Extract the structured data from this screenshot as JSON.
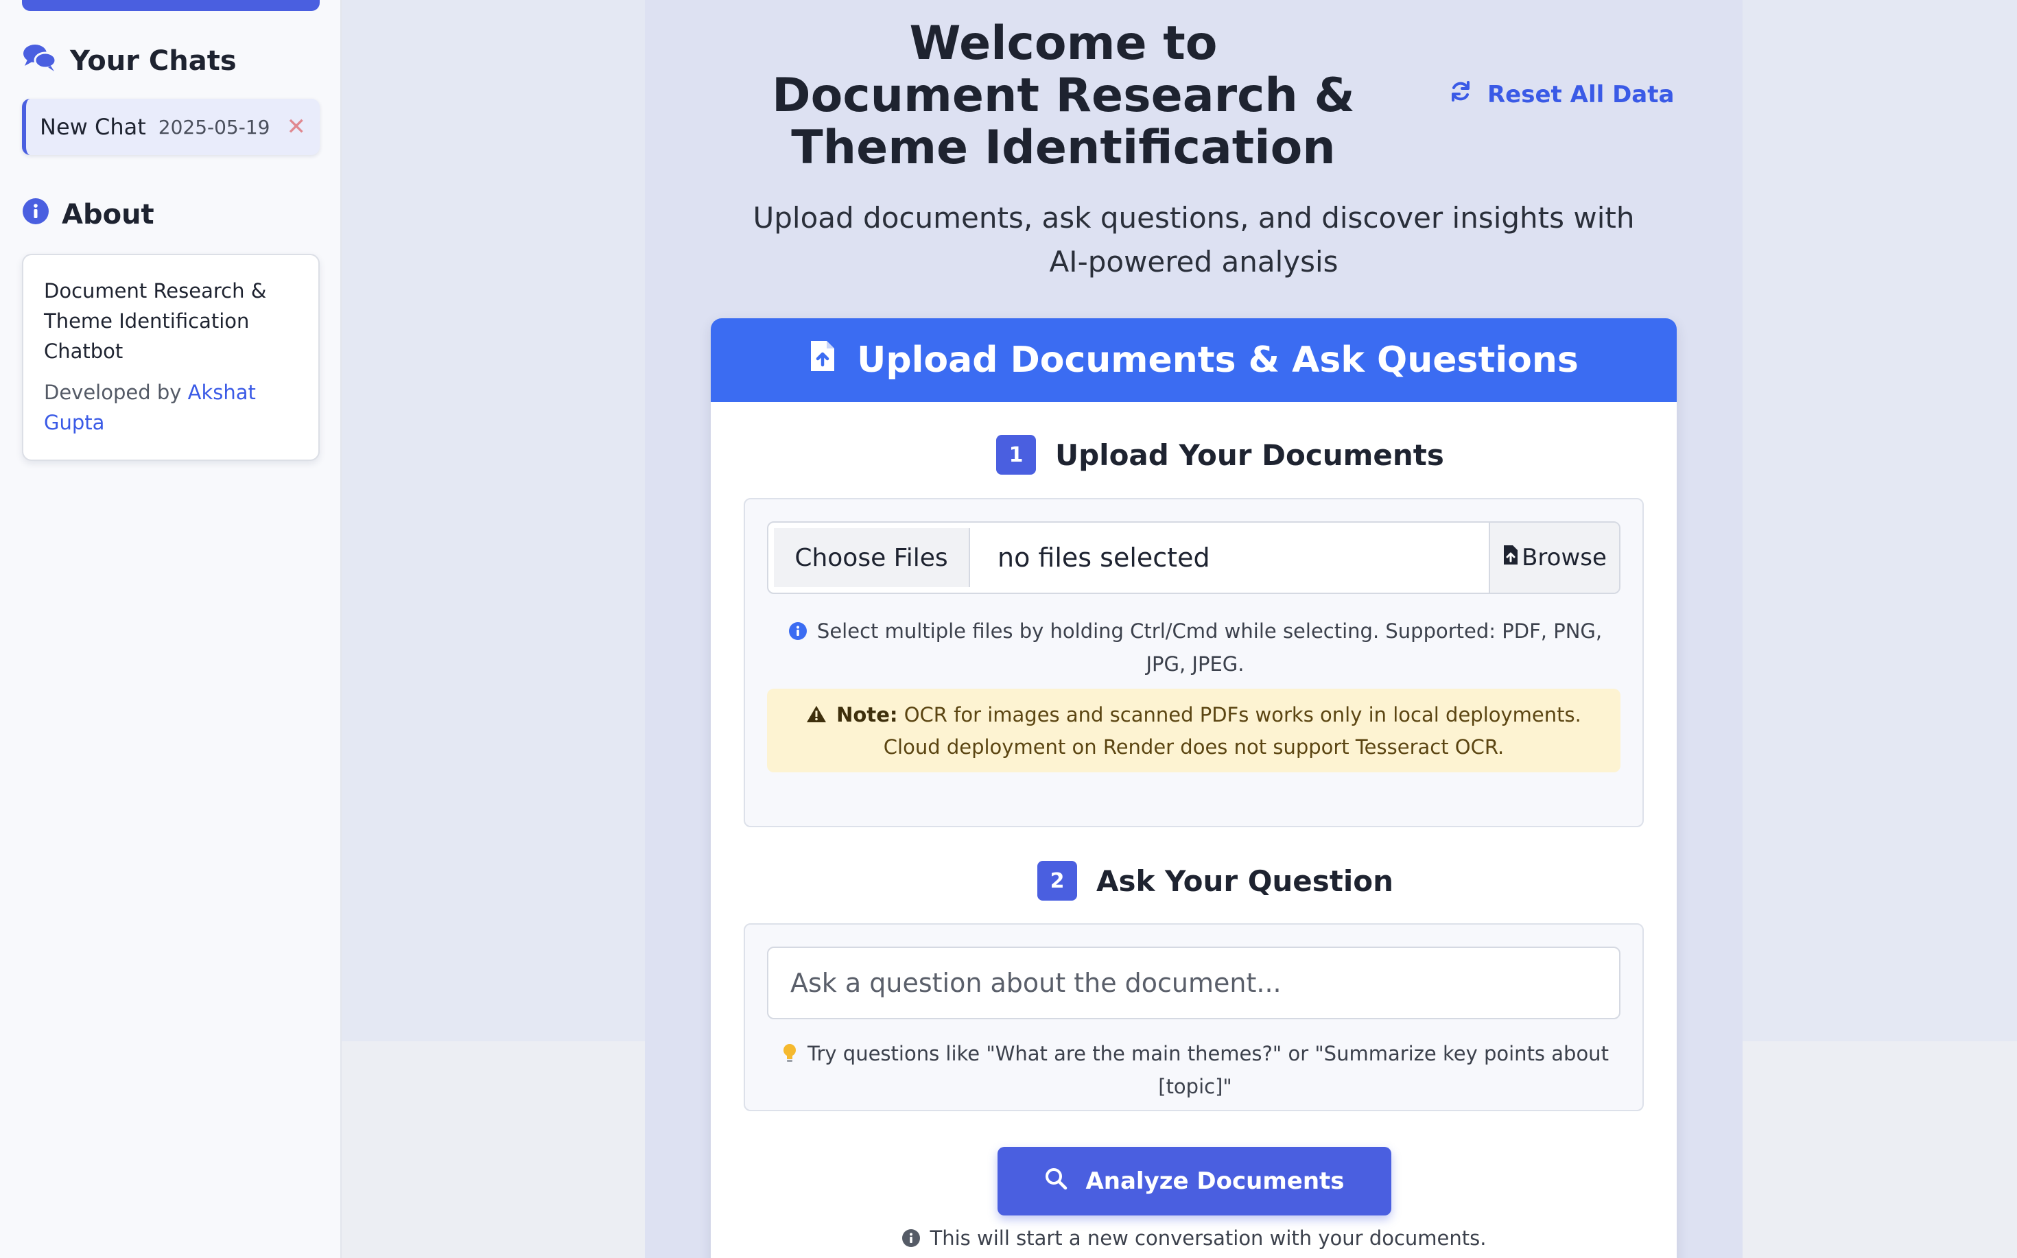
{
  "sidebar": {
    "chats_heading": "Your Chats",
    "chats": [
      {
        "name": "New Chat",
        "date": "2025-05-19"
      }
    ],
    "about_heading": "About",
    "about_description": "Document Research & Theme Identification Chatbot",
    "developed_by_prefix": "Developed by",
    "developer_name": "Akshat Gupta"
  },
  "header": {
    "title": "Welcome to Document Research & Theme Identification",
    "reset_label": "Reset All Data",
    "subtitle": "Upload documents, ask questions, and discover insights with AI-powered analysis"
  },
  "card": {
    "header_title": "Upload Documents & Ask Questions",
    "step1": {
      "number": "1",
      "title": "Upload Your Documents",
      "choose_label": "Choose Files",
      "file_status": "no files selected",
      "browse_label": "Browse",
      "hint": "Select multiple files by holding Ctrl/Cmd while selecting. Supported: PDF, PNG, JPG, JPEG.",
      "note_label": "Note:",
      "note_text": "OCR for images and scanned PDFs works only in local deployments. Cloud deployment on Render does not support Tesseract OCR."
    },
    "step2": {
      "number": "2",
      "title": "Ask Your Question",
      "placeholder": "Ask a question about the document...",
      "hint": "Try questions like \"What are the main themes?\" or \"Summarize key points about [topic]\""
    },
    "analyze_label": "Analyze Documents",
    "footer_note": "This will start a new conversation with your documents."
  },
  "icons": {
    "chats": "comments-icon",
    "about": "info-circle-icon",
    "reset": "refresh-icon",
    "upload": "file-upload-icon",
    "browse": "file-upload-icon",
    "hint": "info-circle-icon",
    "note": "warning-icon",
    "idea": "lightbulb-icon",
    "search": "search-icon"
  },
  "colors": {
    "accent": "#4a5fe0",
    "header_blue": "#3b6cf2",
    "link": "#3a5ae6",
    "note_bg": "#fdf3d2",
    "close_x": "#e08890"
  }
}
